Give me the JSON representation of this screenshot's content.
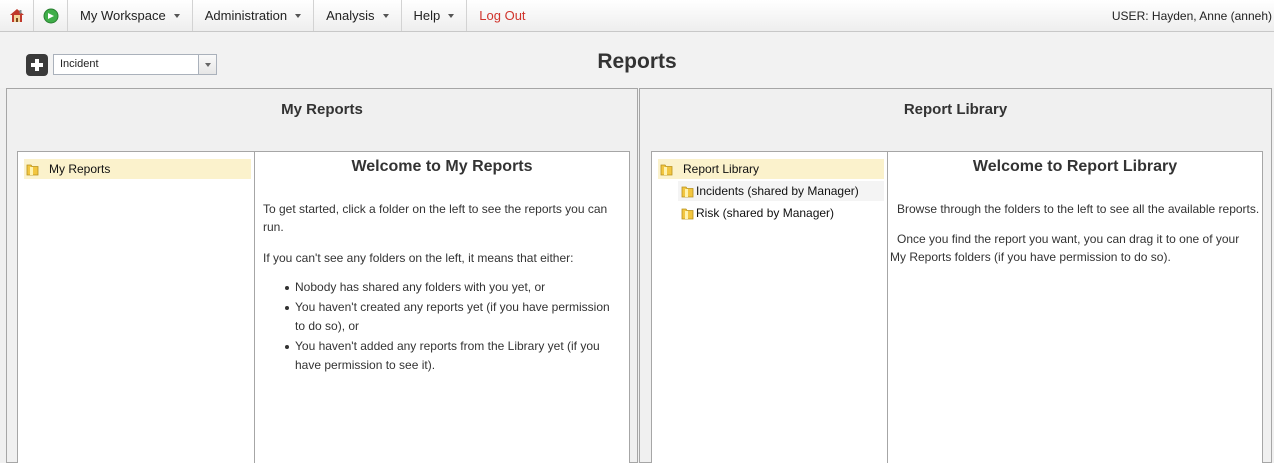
{
  "nav": {
    "home_icon": "home-icon",
    "refresh_icon": "green-refresh-icon",
    "items": [
      {
        "label": "My Workspace",
        "has_dropdown": true
      },
      {
        "label": "Administration",
        "has_dropdown": true
      },
      {
        "label": "Analysis",
        "has_dropdown": true
      },
      {
        "label": "Help",
        "has_dropdown": true
      }
    ],
    "logout_label": "Log Out",
    "user_label": "USER: Hayden, Anne (anneh)"
  },
  "header": {
    "add_icon": "plus-icon",
    "combo_value": "Incident",
    "page_title": "Reports"
  },
  "my_reports": {
    "title": "My Reports",
    "tree_root": "My Reports",
    "welcome_title": "Welcome to My Reports",
    "para1": "To get started, click a folder on the left to see the reports you can run.",
    "para2": "If you can't see any folders on the left, it means that either:",
    "bullets": [
      "Nobody has shared any folders with you yet, or",
      "You haven't created any reports yet (if you have permission to do so), or",
      "You haven't added any reports from the Library yet (if you have permission to see it)."
    ]
  },
  "library": {
    "title": "Report Library",
    "tree_root": "Report Library",
    "children": [
      "Incidents (shared by Manager)",
      "Risk (shared by Manager)"
    ],
    "welcome_title": "Welcome to Report Library",
    "para1": "Browse through the folders to the left to see all the available reports.",
    "para2": "Once you find the report you want, you can drag it to one of your My Reports folders (if you have permission to do so)."
  },
  "colors": {
    "logout": "#d0342c",
    "tree_selected_bg": "#fbf2cc",
    "folder_yellow": "#f2c640"
  }
}
